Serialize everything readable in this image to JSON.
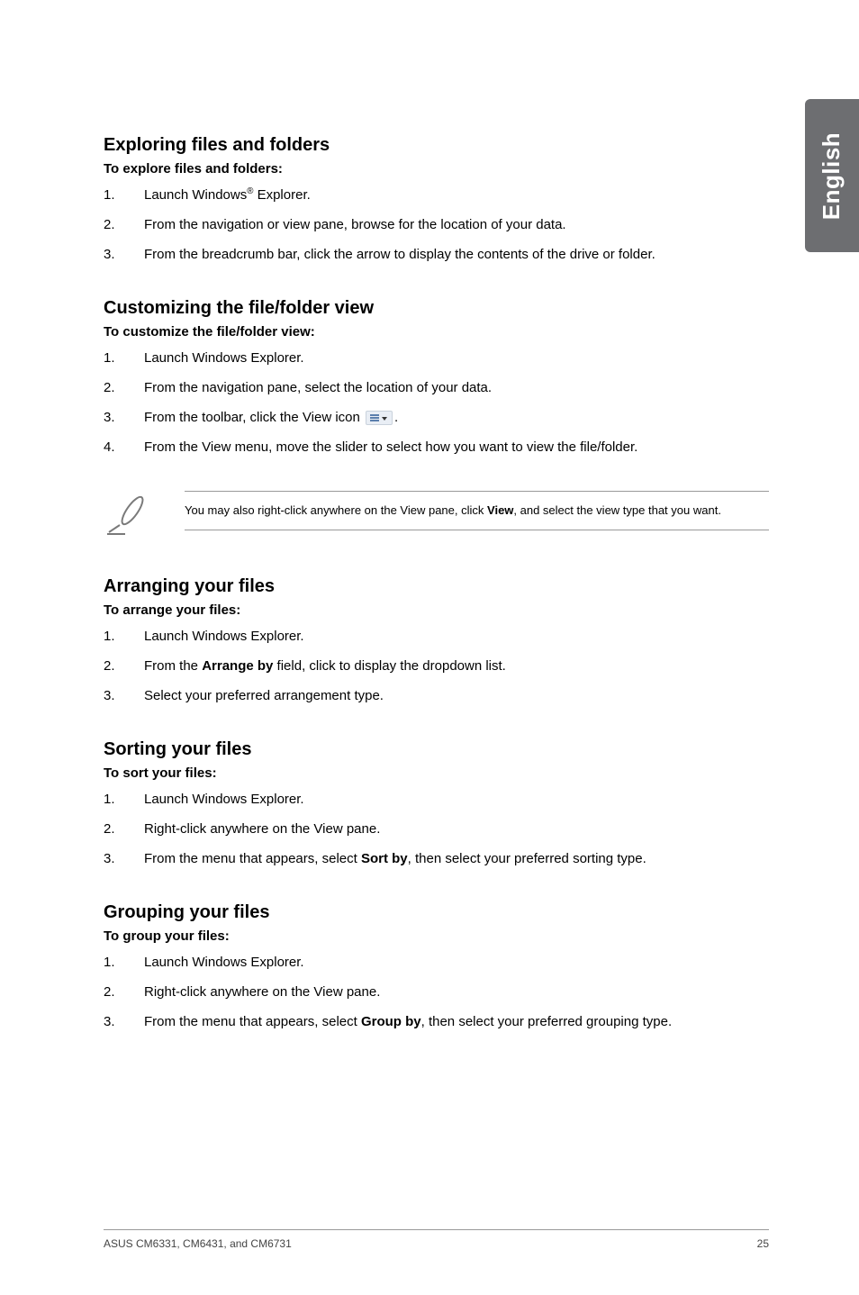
{
  "side_tab": "English",
  "sections": {
    "explore": {
      "heading": "Exploring files and folders",
      "sub": "To explore files and folders:",
      "items": [
        {
          "n": "1.",
          "pre": "Launch Windows",
          "sup": "®",
          "post": " Explorer."
        },
        {
          "n": "2.",
          "text": "From the navigation or view pane, browse for the location of your data."
        },
        {
          "n": "3.",
          "text": "From the breadcrumb bar, click the arrow to display the contents of the drive or folder."
        }
      ]
    },
    "customize": {
      "heading": "Customizing the file/folder view",
      "sub": "To customize the file/folder view:",
      "items": [
        {
          "n": "1.",
          "text": "Launch Windows Explorer."
        },
        {
          "n": "2.",
          "text": "From the navigation pane, select the location of your data."
        },
        {
          "n": "3.",
          "pre": "From the toolbar, click the View icon ",
          "icon": true,
          "post": "."
        },
        {
          "n": "4.",
          "text": "From the View menu, move the slider to select how you want to view the file/folder."
        }
      ]
    },
    "callout": {
      "pre": "You may also right-click anywhere on the View pane, click ",
      "bold": "View",
      "post": ", and select the view type that you want."
    },
    "arrange": {
      "heading": "Arranging your files",
      "sub": "To arrange your files:",
      "items": [
        {
          "n": "1.",
          "text": "Launch Windows Explorer."
        },
        {
          "n": "2.",
          "pre": "From the ",
          "bold": "Arrange by",
          "post": " field, click to display the dropdown list."
        },
        {
          "n": "3.",
          "text": "Select your preferred arrangement type."
        }
      ]
    },
    "sort": {
      "heading": "Sorting your files",
      "sub": "To sort your files:",
      "items": [
        {
          "n": "1.",
          "text": "Launch Windows Explorer."
        },
        {
          "n": "2.",
          "text": "Right-click anywhere on the View pane."
        },
        {
          "n": "3.",
          "pre": "From the menu that appears, select ",
          "bold": "Sort by",
          "post": ", then select your preferred sorting type."
        }
      ]
    },
    "group": {
      "heading": "Grouping your files",
      "sub": "To group your files:",
      "items": [
        {
          "n": "1.",
          "text": "Launch Windows Explorer."
        },
        {
          "n": "2.",
          "text": "Right-click anywhere on the View pane."
        },
        {
          "n": "3.",
          "pre": "From the menu that appears, select ",
          "bold": "Group by",
          "post": ", then select your preferred grouping type."
        }
      ]
    }
  },
  "footer": {
    "left": "ASUS CM6331, CM6431, and CM6731",
    "right": "25"
  }
}
